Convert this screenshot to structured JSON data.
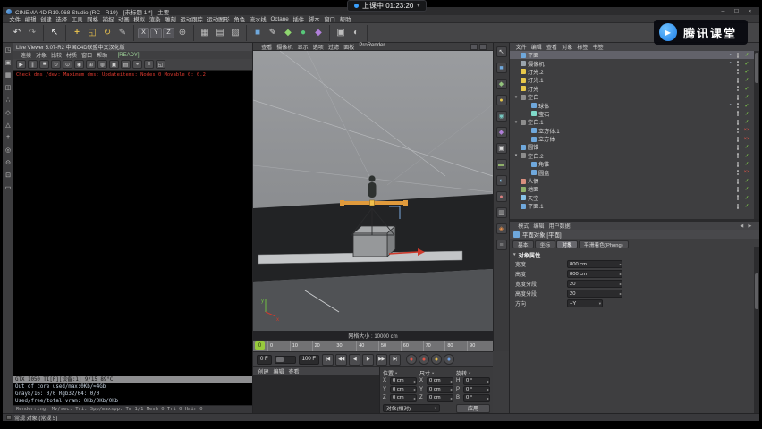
{
  "overlay": {
    "class_status": "上课中 01:23:20",
    "brand": "腾讯课堂"
  },
  "titlebar": {
    "title": "CINEMA 4D R19.068 Studio (RC - R19) - [未标题 1 *] - 主要",
    "minimize": "─",
    "maximize": "☐",
    "close": "×"
  },
  "menubar": {
    "items": [
      "文件",
      "编辑",
      "创建",
      "选择",
      "工具",
      "网格",
      "捕捉",
      "动画",
      "模拟",
      "渲染",
      "雕刻",
      "运动跟踪",
      "运动图形",
      "角色",
      "流水线",
      "Octane",
      "插件",
      "脚本",
      "窗口",
      "帮助"
    ]
  },
  "toolbar": {
    "groups": [
      [
        {
          "n": "undo-icon",
          "g": "↶",
          "cls": "tbtn",
          "s": "color:#e0e0e0"
        },
        {
          "n": "redo-icon",
          "g": "↷",
          "cls": "tbtn",
          "s": "color:#9f9f9f"
        }
      ],
      [
        {
          "n": "live-selection-tool",
          "g": "↖",
          "cls": "tbtn",
          "s": "color:#e8e8e8"
        }
      ],
      [
        {
          "n": "move-tool",
          "g": "+",
          "cls": "tbtn",
          "s": "color:#e3bd4e;font-weight:bold"
        },
        {
          "n": "scale-tool",
          "g": "◱",
          "cls": "tbtn",
          "s": "color:#e3bd4e"
        },
        {
          "n": "rotate-tool",
          "g": "↻",
          "cls": "tbtn",
          "s": "color:#e3bd4e"
        },
        {
          "n": "last-used-tool",
          "g": "✎",
          "cls": "tbtn",
          "s": "color:#bdbdbd"
        }
      ],
      [
        {
          "n": "lock-x-axis-button",
          "g": "X",
          "cls": "tbox"
        },
        {
          "n": "lock-y-axis-button",
          "g": "Y",
          "cls": "tbox"
        },
        {
          "n": "lock-z-axis-button",
          "g": "Z",
          "cls": "tbox"
        },
        {
          "n": "coordinate-system-button",
          "g": "⊕",
          "cls": "tbtn",
          "s": "color:#bdbdbd"
        }
      ],
      [
        {
          "n": "render-view-button",
          "g": "▦",
          "cls": "tbtn",
          "s": "color:#bdbdbd"
        },
        {
          "n": "render-picture-viewer-button",
          "g": "▤",
          "cls": "tbtn",
          "s": "color:#bdbdbd"
        },
        {
          "n": "render-settings-button",
          "g": "▧",
          "cls": "tbtn",
          "s": "color:#bdbdbd"
        }
      ],
      [
        {
          "n": "primitive-cube-button",
          "g": "■",
          "cls": "tbtn",
          "s": "color:#6fa8dc"
        },
        {
          "n": "pen-spline-button",
          "g": "✎",
          "cls": "tbtn",
          "s": "color:#d8d8d8"
        },
        {
          "n": "generators-button",
          "g": "◆",
          "cls": "tbtn",
          "s": "color:#8fd66f"
        },
        {
          "n": "mograph-button",
          "g": "●",
          "cls": "tbtn",
          "s": "color:#57c77a"
        },
        {
          "n": "deformers-button",
          "g": "◆",
          "cls": "tbtn",
          "s": "color:#b07fd9"
        }
      ],
      [
        {
          "n": "scene-camera-button",
          "g": "▣",
          "cls": "tbtn",
          "s": "color:#bdbdbd"
        },
        {
          "n": "scene-environment-button",
          "g": "◐",
          "cls": "tbtn",
          "s": "color:#bdbdbd"
        }
      ]
    ]
  },
  "left_palette": {
    "items": [
      {
        "n": "convert-editable-icon",
        "g": "◳"
      },
      {
        "n": "model-mode-icon",
        "g": "▣"
      },
      {
        "n": "texture-mode-icon",
        "g": "▦"
      },
      {
        "n": "workplane-mode-icon",
        "g": "◫"
      },
      {
        "n": "points-mode-icon",
        "g": "∴"
      },
      {
        "n": "edges-mode-icon",
        "g": "◇"
      },
      {
        "n": "polygons-mode-icon",
        "g": "△"
      },
      {
        "n": "enable-axis-icon",
        "g": "+"
      },
      {
        "n": "viewport-solo-icon",
        "g": "◎"
      },
      {
        "n": "enable-snap-icon",
        "g": "⊙"
      },
      {
        "n": "workplane-lock-icon",
        "g": "⊡"
      },
      {
        "n": "quantize-icon",
        "g": "▭"
      }
    ]
  },
  "right_palette": {
    "items": [
      {
        "n": "side-select-icon",
        "g": "↖",
        "s": "color:#d8d8d8"
      },
      {
        "n": "side-cube-icon",
        "g": "■",
        "s": "color:#6fa8dc"
      },
      {
        "n": "side-spline-icon",
        "g": "◆",
        "s": "color:#93c47d"
      },
      {
        "n": "side-light-icon",
        "g": "●",
        "s": "color:#e8c84a"
      },
      {
        "n": "side-material-icon",
        "g": "◉",
        "s": "color:#76c7c0"
      },
      {
        "n": "side-deformer-icon",
        "g": "◆",
        "s": "color:#b07fd9"
      },
      {
        "n": "side-camera-icon",
        "g": "▣",
        "s": "color:#d8d8d8"
      },
      {
        "n": "side-floor-icon",
        "g": "▬",
        "s": "color:#8fb06a"
      },
      {
        "n": "side-sky-icon",
        "g": "◐",
        "s": "color:#87c3e8"
      },
      {
        "n": "side-physics-icon",
        "g": "●",
        "s": "color:#d97f7f"
      },
      {
        "n": "side-display-icon",
        "g": "▥",
        "s": "color:#bdbdbd"
      },
      {
        "n": "side-render-icon",
        "g": "◈",
        "s": "color:#e8904a"
      },
      {
        "n": "side-settings-icon",
        "g": "≡",
        "s": "color:#9a9a9a"
      }
    ]
  },
  "octane": {
    "title": "Live Viewer 5.07-R2 中国C4D联盟中文汉化版",
    "menus": [
      "连接",
      "对象",
      "比较",
      "材质",
      "窗口",
      "帮助"
    ],
    "ready": "[READY]",
    "tools": [
      {
        "n": "octane-start-render-icon",
        "g": "▶"
      },
      {
        "n": "octane-pause-icon",
        "g": "∥"
      },
      {
        "n": "octane-stop-icon",
        "g": "■"
      },
      {
        "n": "octane-restart-icon",
        "g": "↻"
      },
      {
        "n": "octane-focus-picker-icon",
        "g": "⊙"
      },
      {
        "n": "octane-white-balance-icon",
        "g": "◉"
      },
      {
        "n": "octane-region-icon",
        "g": "⊞"
      },
      {
        "n": "octane-clay-mode-icon",
        "g": "◍"
      },
      {
        "n": "octane-lock-camera-icon",
        "g": "▣"
      },
      {
        "n": "octane-film-settings-icon",
        "g": "▤"
      },
      {
        "n": "octane-denoise-icon",
        "g": "◒"
      },
      {
        "n": "octane-settings-icon",
        "g": "≡"
      },
      {
        "n": "octane-expand-icon",
        "g": "◱"
      }
    ],
    "console": "Check dms /dev: Maximum dms: Updateitems: Nodes 0 Movable 0: 0.2",
    "gpu": [
      {
        "text": "GTX 1050 TI[P][设备:1]      9/15      89°C",
        "cls": "gpu-line hl"
      },
      {
        "text": "Out of core used/max:0Kb/≈4Gb",
        "cls": "gpu-line"
      },
      {
        "text": "Gray8/16: 0/0    Rgb32/64: 0/0",
        "cls": "gpu-line"
      },
      {
        "text": "Used/free/total vram: 0Kb/0Kb/0Kb",
        "cls": "gpu-line"
      }
    ],
    "status": "Renderring:   Mv/sec:   Tri:   Spp/maxspp:   Tm 1/1   Mesh 0   Tri 0   Hair 0"
  },
  "viewport": {
    "menus": [
      "查看",
      "摄像机",
      "显示",
      "选项",
      "过滤",
      "面板",
      "ProRender"
    ],
    "grid_label": "网格大小 : 10000 cm",
    "axis_x": "x",
    "axis_y": "y"
  },
  "timeline": {
    "marker": "0",
    "ticks": [
      "0",
      "10",
      "20",
      "30",
      "40",
      "50",
      "60",
      "70",
      "80",
      "90"
    ]
  },
  "transport": {
    "frame_current": "0 F",
    "frame_end": "100 F",
    "buttons": [
      {
        "n": "goto-start-button",
        "g": "|◀"
      },
      {
        "n": "prev-key-button",
        "g": "◀◀"
      },
      {
        "n": "prev-frame-button",
        "g": "◀"
      },
      {
        "n": "play-button",
        "g": "▶"
      },
      {
        "n": "next-frame-button",
        "g": "▶▶"
      },
      {
        "n": "goto-end-button",
        "g": "▶|"
      }
    ],
    "records": [
      {
        "n": "record-keyframe-button",
        "s": "color:#e05548"
      },
      {
        "n": "autokey-button",
        "s": "color:#e05548"
      },
      {
        "n": "record-position-button",
        "s": "color:#e8c04a"
      },
      {
        "n": "record-parameter-button",
        "s": "color:#6f9fe0"
      }
    ]
  },
  "materials": {
    "menus": [
      "创建",
      "编辑",
      "查看"
    ]
  },
  "coordinates": {
    "columns": [
      {
        "title": "位置",
        "rows": [
          {
            "k": "X",
            "v": "0 cm"
          },
          {
            "k": "Y",
            "v": "0 cm"
          },
          {
            "k": "Z",
            "v": "0 cm"
          }
        ]
      },
      {
        "title": "尺寸",
        "rows": [
          {
            "k": "X",
            "v": "0 cm"
          },
          {
            "k": "Y",
            "v": "0 cm"
          },
          {
            "k": "Z",
            "v": "0 cm"
          }
        ]
      },
      {
        "title": "旋转",
        "rows": [
          {
            "k": "H",
            "v": "0 °"
          },
          {
            "k": "P",
            "v": "0 °"
          },
          {
            "k": "B",
            "v": "0 °"
          }
        ]
      }
    ],
    "mode": "对象(相对)",
    "apply": "应用"
  },
  "object_manager": {
    "menus": [
      "文件",
      "编辑",
      "查看",
      "对象",
      "标签",
      "书签"
    ],
    "items": [
      {
        "c": "trow sel",
        "a": "",
        "i": "background:#6fa8dc",
        "t": "平面",
        "m": "✓",
        "mc": "mark ok",
        "tag": "▪"
      },
      {
        "c": "trow",
        "a": "",
        "i": "background:#9aa4ad",
        "t": "摄像机",
        "m": "✓",
        "mc": "mark ok",
        "tag": "▪"
      },
      {
        "c": "trow",
        "a": "",
        "i": "background:#e8c84a",
        "t": "灯光.2",
        "m": "✓",
        "mc": "mark ok",
        "tag": ""
      },
      {
        "c": "trow",
        "a": "",
        "i": "background:#e8c84a",
        "t": "灯光.1",
        "m": "✓",
        "mc": "mark ok",
        "tag": ""
      },
      {
        "c": "trow",
        "a": "",
        "i": "background:#e8c84a",
        "t": "灯光",
        "m": "✓",
        "mc": "mark ok",
        "tag": ""
      },
      {
        "c": "trow",
        "a": "▾",
        "i": "background:#8d8d8d",
        "t": "空白",
        "m": "✓",
        "mc": "mark ok",
        "tag": ""
      },
      {
        "c": "trow d1",
        "a": "",
        "i": "background:#6fa8dc",
        "t": "球体",
        "m": "✓",
        "mc": "mark ok",
        "tag": "▪"
      },
      {
        "c": "trow d1",
        "a": "",
        "i": "background:#7fd9c9",
        "t": "宝石",
        "m": "✓",
        "mc": "mark ok",
        "tag": ""
      },
      {
        "c": "trow",
        "a": "▾",
        "i": "background:#8d8d8d",
        "t": "空白.1",
        "m": "✓",
        "mc": "mark ok",
        "tag": ""
      },
      {
        "c": "trow d1",
        "a": "",
        "i": "background:#6fa8dc",
        "t": "立方体.1",
        "m": "××",
        "mc": "mark bad",
        "tag": ""
      },
      {
        "c": "trow d1",
        "a": "",
        "i": "background:#6fa8dc",
        "t": "立方体",
        "m": "××",
        "mc": "mark bad",
        "tag": ""
      },
      {
        "c": "trow",
        "a": "",
        "i": "background:#6fa8dc",
        "t": "圆锥",
        "m": "✓",
        "mc": "mark ok",
        "tag": ""
      },
      {
        "c": "trow",
        "a": "▾",
        "i": "background:#8d8d8d",
        "t": "空白.2",
        "m": "✓",
        "mc": "mark ok",
        "tag": ""
      },
      {
        "c": "trow d1",
        "a": "",
        "i": "background:#6fa8dc",
        "t": "角锥",
        "m": "✓",
        "mc": "mark ok",
        "tag": ""
      },
      {
        "c": "trow d1",
        "a": "",
        "i": "background:#6fa8dc",
        "t": "圆盘",
        "m": "××",
        "mc": "mark bad",
        "tag": ""
      },
      {
        "c": "trow",
        "a": "",
        "i": "background:#d98f7f",
        "t": "人偶",
        "m": "✓",
        "mc": "mark ok",
        "tag": ""
      },
      {
        "c": "trow",
        "a": "",
        "i": "background:#8fb06a",
        "t": "地面",
        "m": "✓",
        "mc": "mark ok",
        "tag": ""
      },
      {
        "c": "trow",
        "a": "",
        "i": "background:#87c3e8",
        "t": "天空",
        "m": "✓",
        "mc": "mark ok",
        "tag": ""
      },
      {
        "c": "trow",
        "a": "",
        "i": "background:#6fa8dc",
        "t": "平面.1",
        "m": "✓",
        "mc": "mark ok",
        "tag": ""
      }
    ]
  },
  "attributes": {
    "menus": [
      "模式",
      "编辑",
      "用户数据"
    ],
    "nav": "◀ ▶",
    "title": "平面对象 [平面]",
    "tabs": [
      {
        "label": "基本",
        "cls": "amtab"
      },
      {
        "label": "坐标",
        "cls": "amtab"
      },
      {
        "label": "对象",
        "cls": "amtab on"
      },
      {
        "label": "平滑着色(Phong)",
        "cls": "amtab"
      }
    ],
    "section": "对象属性",
    "fields": [
      {
        "label": "宽度",
        "value": "800 cm",
        "cls": "vbox spin"
      },
      {
        "label": "高度",
        "value": "800 cm",
        "cls": "vbox spin"
      },
      {
        "label": "宽度分段",
        "value": "20",
        "cls": "vbox spin"
      },
      {
        "label": "高度分段",
        "value": "20",
        "cls": "vbox spin"
      },
      {
        "label": "方向",
        "value": "+Y",
        "cls": "vbox sel"
      }
    ]
  },
  "statusbar": {
    "left": "常规 对象 (常规 5)"
  }
}
